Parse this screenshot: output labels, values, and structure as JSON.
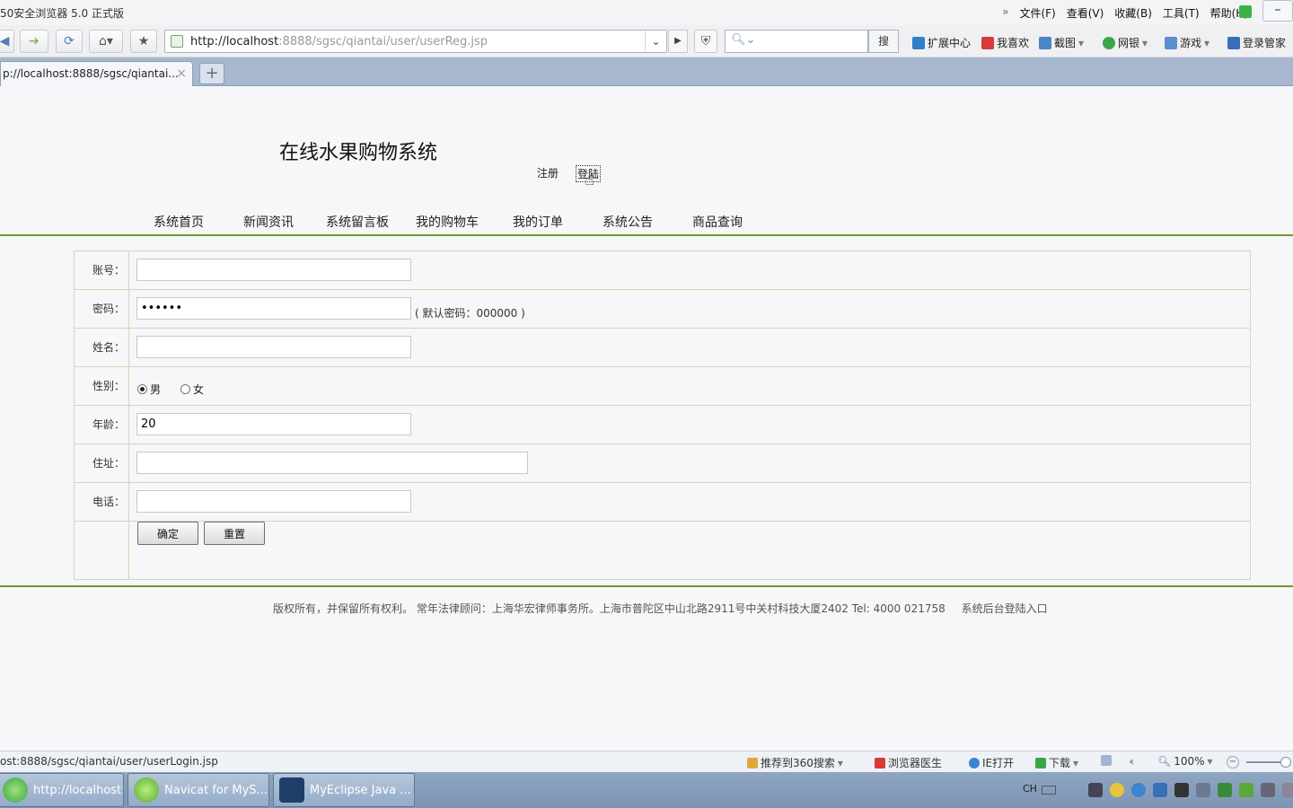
{
  "browser": {
    "title": "50安全浏览器 5.0 正式版",
    "menus": [
      "文件(F)",
      "查看(V)",
      "收藏(B)",
      "工具(T)",
      "帮助(H)"
    ],
    "minimize": "–",
    "url_host": "http://localhost",
    "url_rest": ":8888/sgsc/qiantai/user/userReg.jsp",
    "search_button": "搜",
    "extensions": [
      "扩展中心",
      "我喜欢",
      "截图",
      "网银",
      "游戏",
      "登录管家"
    ],
    "tab_title": "p://localhost:8888/sgsc/qiantai...",
    "tab_close": "×",
    "new_tab": "+"
  },
  "page": {
    "site_title": "在线水果购物系统",
    "register_link": "注册",
    "login_link": "登陆",
    "nav": [
      "系统首页",
      "新闻资讯",
      "系统留言板",
      "我的购物车",
      "我的订单",
      "系统公告",
      "商品查询"
    ],
    "form": {
      "account_label": "账号：",
      "account_value": "",
      "password_label": "密码：",
      "password_value": "000000",
      "password_hint": "( 默认密码：000000 )",
      "name_label": "姓名：",
      "name_value": "",
      "gender_label": "性别：",
      "gender_male": "男",
      "gender_female": "女",
      "gender_selected": "男",
      "age_label": "年龄：",
      "age_value": "20",
      "address_label": "住址：",
      "address_value": "",
      "phone_label": "电话：",
      "phone_value": "",
      "submit_button": "确定",
      "reset_button": "重置"
    },
    "footer": "版权所有，并保留所有权利。 常年法律顾问：上海华宏律师事务所。上海市普陀区中山北路2911号中关村科技大厦2402 Tel: 4000 021758",
    "admin_link": "系统后台登陆入口"
  },
  "statusbar": {
    "status_text": "ost:8888/sgsc/qiantai/user/userLogin.jsp",
    "recommend": "推荐到360搜索",
    "doctor": "浏览器医生",
    "ie_open": "IE打开",
    "download": "下载",
    "zoom": "100%"
  },
  "taskbar": {
    "tasks": [
      "http://localhost:...",
      "Navicat for MyS...",
      "MyEclipse Java ..."
    ],
    "ime": "CH"
  },
  "colors": {
    "accent_green": "#6d9a3a",
    "tab_bar": "#a6b7cf"
  }
}
